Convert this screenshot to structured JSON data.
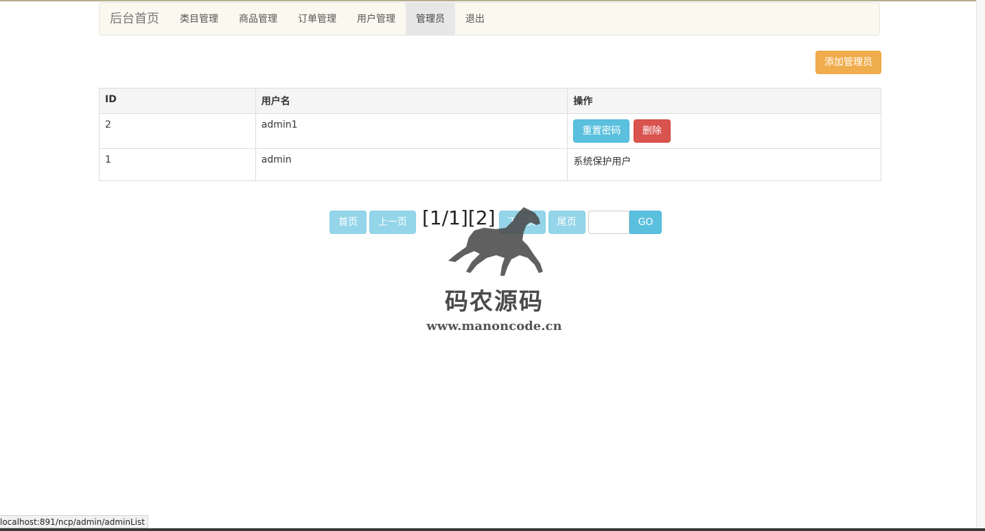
{
  "nav": {
    "brand": "后台首页",
    "items": [
      {
        "label": "类目管理"
      },
      {
        "label": "商品管理"
      },
      {
        "label": "订单管理"
      },
      {
        "label": "用户管理"
      },
      {
        "label": "管理员",
        "active": true
      },
      {
        "label": "退出"
      }
    ]
  },
  "toolbar": {
    "add_label": "添加管理员"
  },
  "table": {
    "headers": [
      "ID",
      "用户名",
      "操作"
    ],
    "rows": [
      {
        "id": "2",
        "username": "admin1",
        "reset_label": "重置密码",
        "delete_label": "删除"
      },
      {
        "id": "1",
        "username": "admin",
        "note": "系统保护用户"
      }
    ]
  },
  "pagination": {
    "first": "首页",
    "prev": "上一页",
    "info": "[1/1][2]",
    "next": "下一页",
    "last": "尾页",
    "go": "GO",
    "input_value": ""
  },
  "watermark": {
    "cn": "码农源码",
    "en": "www.manoncode.cn"
  },
  "status": {
    "url": "localhost:891/ncp/admin/adminList"
  },
  "colors": {
    "warning": "#f0ad4e",
    "info": "#5bc0de",
    "danger": "#d9534f",
    "navbar_bg": "#fbf8ef"
  }
}
